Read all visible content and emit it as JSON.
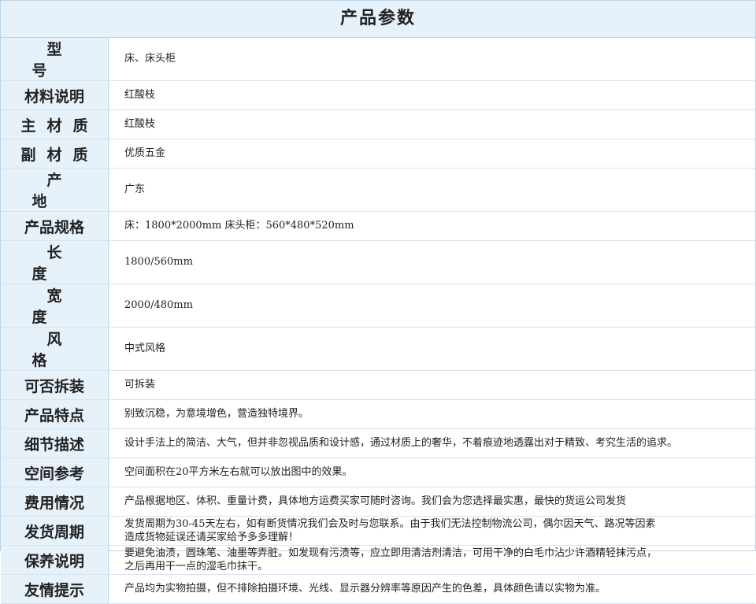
{
  "header": {
    "title": "产品参数"
  },
  "rows": [
    {
      "label": "型号",
      "value": "床、床头柜"
    },
    {
      "label": "材料说明",
      "value": "红酸枝"
    },
    {
      "label": "主材质",
      "value": "红酸枝"
    },
    {
      "label": "副材质",
      "value": "优质五金"
    },
    {
      "label": "产地",
      "value": "广东"
    },
    {
      "label": "产品规格",
      "value": "床：1800*2000mm 床头柜：560*480*520mm"
    },
    {
      "label": "长度",
      "value": "1800/560mm"
    },
    {
      "label": "宽度",
      "value": "2000/480mm"
    },
    {
      "label": "风格",
      "value": "中式风格"
    },
    {
      "label": "可否拆装",
      "value": "可拆装"
    },
    {
      "label": "产品特点",
      "value": "别致沉稳，为意境增色，营造独特境界。"
    },
    {
      "label": "细节描述",
      "value": "设计手法上的简洁、大气，但并非忽视品质和设计感，通过材质上的奢华，不着痕迹地透露出对于精致、考究生活的追求。"
    },
    {
      "label": "空间参考",
      "value": "空间面积在20平方米左右就可以放出图中的效果。"
    },
    {
      "label": "费用情况",
      "value": "产品根据地区、体积、重量计费，具体地方运费买家可随时咨询。我们会为您选择最实惠，最快的货运公司发货"
    },
    {
      "label": "发货周期",
      "value": "发货周期为30-45天左右，如有断货情况我们会及时与您联系。由于我们无法控制物流公司，偶尔因天气、路况等因素",
      "value2": "造成货物延误还请买家给予多多理解！"
    },
    {
      "label": "保养说明",
      "value": "要避免油渍，圆珠笔、油墨等弄脏。如发现有污渍等，应立即用清洁剂清洁，可用干净的白毛巾沾少许酒精轻抹污点，",
      "value2": "之后再用干一点的湿毛巾抹干。"
    },
    {
      "label": "友情提示",
      "value": "产品均为实物拍摄，但不排除拍摄环境、光线、显示器分辨率等原因产生的色差，具体颜色请以实物为准。"
    }
  ]
}
